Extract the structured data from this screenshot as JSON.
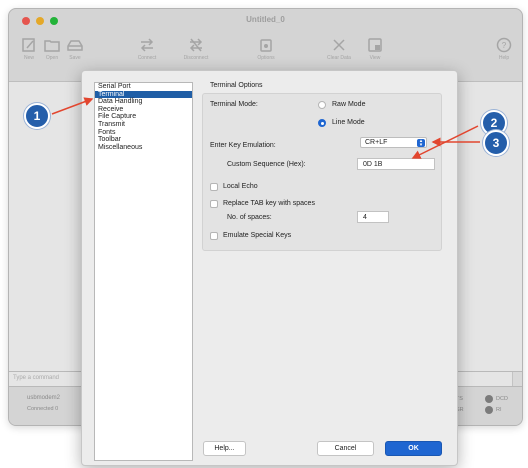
{
  "window": {
    "title": "Untitled_0"
  },
  "toolbar": {
    "items": [
      {
        "icon": "new-icon",
        "label": "New"
      },
      {
        "icon": "open-icon",
        "label": "Open"
      },
      {
        "icon": "save-icon",
        "label": "Save"
      },
      {
        "icon": "connect-icon",
        "label": "Connect"
      },
      {
        "icon": "disconnect-icon",
        "label": "Disconnect"
      },
      {
        "icon": "options-icon",
        "label": "Options"
      },
      {
        "icon": "clear-data-icon",
        "label": "Clear Data"
      },
      {
        "icon": "view-icon",
        "label": "View"
      },
      {
        "icon": "help-icon",
        "label": "Help"
      }
    ]
  },
  "input_bar": {
    "placeholder": "Type a command"
  },
  "status_bar": {
    "port": "usbmodem2",
    "connection": "Connected 0",
    "signals": [
      "RTS",
      "DCD",
      "DSR",
      "RI"
    ]
  },
  "dialog": {
    "categories": [
      "Serial Port",
      "Terminal",
      "Data Handling",
      "Receive",
      "File Capture",
      "Transmit",
      "Fonts",
      "Toolbar",
      "Miscellaneous"
    ],
    "selected_category": "Terminal",
    "group_title": "Terminal Options",
    "terminal_mode_label": "Terminal Mode:",
    "raw_mode_label": "Raw Mode",
    "line_mode_label": "Line Mode",
    "key_emulation_label": "Enter Key Emulation:",
    "key_emulation_value": "CR+LF",
    "custom_sequence_label": "Custom Sequence (Hex):",
    "custom_sequence_value": "0D 1B",
    "local_echo_label": "Local Echo",
    "replace_tab_label": "Replace TAB key with spaces",
    "num_spaces_label": "No. of spaces:",
    "num_spaces_value": "4",
    "emulate_keys_label": "Emulate Special Keys",
    "help_button": "Help...",
    "cancel_button": "Cancel",
    "ok_button": "OK"
  },
  "callouts": [
    "1",
    "2",
    "3"
  ],
  "colors": {
    "accent": "#1f66d1",
    "callout": "#245eaa",
    "arrow": "#e2462f"
  }
}
